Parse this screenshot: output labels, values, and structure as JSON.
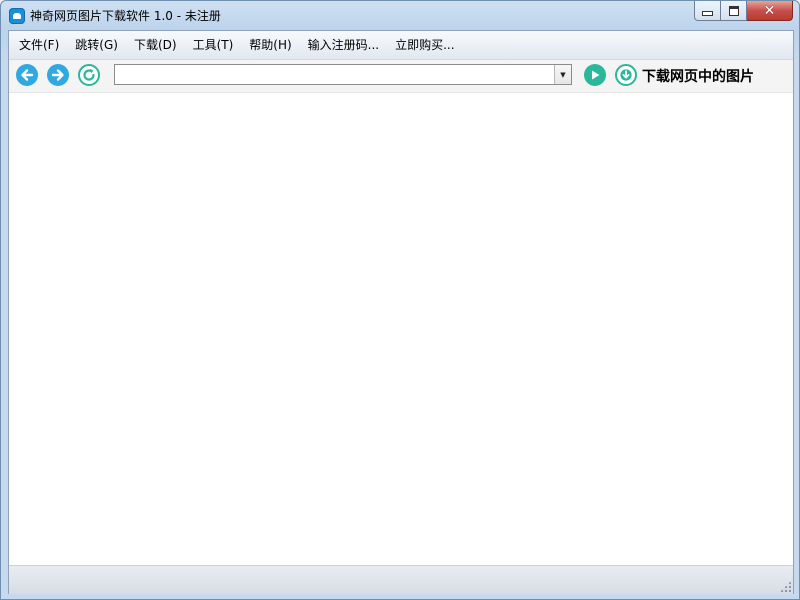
{
  "window": {
    "title": "神奇网页图片下载软件 1.0 - 未注册",
    "icon": "app-logo-icon",
    "controls": [
      "minimize-icon",
      "maximize-icon",
      "close-icon"
    ]
  },
  "menu": {
    "items": [
      {
        "label": "文件(F)"
      },
      {
        "label": "跳转(G)"
      },
      {
        "label": "下载(D)"
      },
      {
        "label": "工具(T)"
      },
      {
        "label": "帮助(H)"
      },
      {
        "label": "输入注册码..."
      },
      {
        "label": "立即购买..."
      }
    ]
  },
  "toolbar": {
    "back_icon": "arrow-left-icon",
    "forward_icon": "arrow-right-icon",
    "refresh_icon": "refresh-icon",
    "url_value": "",
    "go_icon": "play-icon",
    "download_icon": "download-icon",
    "download_label": "下载网页中的图片"
  },
  "colors": {
    "accent_blue": "#2fa9e0",
    "accent_green": "#2bb79a",
    "title_bar": "#bcd3ec"
  }
}
